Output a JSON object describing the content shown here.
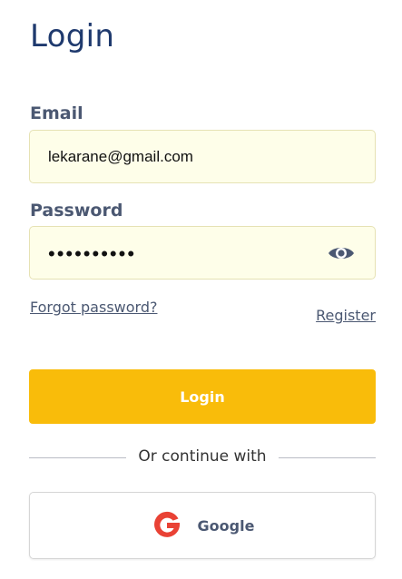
{
  "page": {
    "title": "Login"
  },
  "form": {
    "email_label": "Email",
    "email_value": "lekarane@gmail.com",
    "password_label": "Password",
    "password_masked": "••••••••••",
    "show_password_icon": "eye-icon",
    "forgot_password": "Forgot password?",
    "register": "Register",
    "login_button": "Login"
  },
  "alt_login": {
    "divider_text": "Or continue with",
    "google_label": "Google",
    "google_icon": "google-g-icon"
  },
  "colors": {
    "title": "#1f3a6e",
    "label": "#4b5872",
    "field_bg": "#fefee9",
    "primary_button": "#f9bc0a",
    "google_red": "#e94235"
  }
}
